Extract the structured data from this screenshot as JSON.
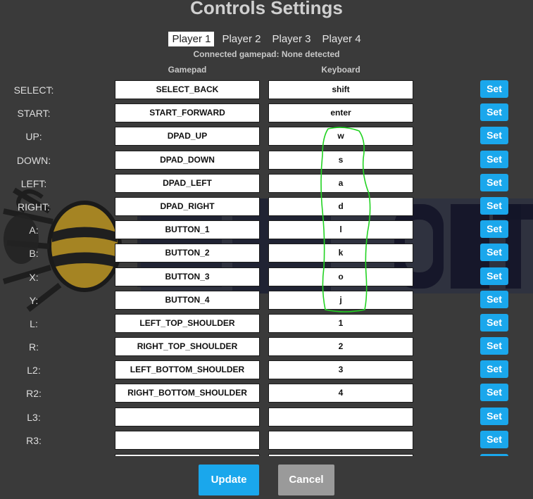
{
  "title": "Controls Settings",
  "tabs": [
    {
      "label": "Player 1",
      "active": true
    },
    {
      "label": "Player 2",
      "active": false
    },
    {
      "label": "Player 3",
      "active": false
    },
    {
      "label": "Player 4",
      "active": false
    }
  ],
  "connected_text": "Connected gamepad: None detected",
  "columns": {
    "gamepad": "Gamepad",
    "keyboard": "Keyboard"
  },
  "rows": [
    {
      "label": "SELECT:",
      "gamepad": "SELECT_BACK",
      "keyboard": "shift"
    },
    {
      "label": "START:",
      "gamepad": "START_FORWARD",
      "keyboard": "enter"
    },
    {
      "label": "UP:",
      "gamepad": "DPAD_UP",
      "keyboard": "w"
    },
    {
      "label": "DOWN:",
      "gamepad": "DPAD_DOWN",
      "keyboard": "s"
    },
    {
      "label": "LEFT:",
      "gamepad": "DPAD_LEFT",
      "keyboard": "a"
    },
    {
      "label": "RIGHT:",
      "gamepad": "DPAD_RIGHT",
      "keyboard": "d"
    },
    {
      "label": "A:",
      "gamepad": "BUTTON_1",
      "keyboard": "l"
    },
    {
      "label": "B:",
      "gamepad": "BUTTON_2",
      "keyboard": "k"
    },
    {
      "label": "X:",
      "gamepad": "BUTTON_3",
      "keyboard": "o"
    },
    {
      "label": "Y:",
      "gamepad": "BUTTON_4",
      "keyboard": "j"
    },
    {
      "label": "L:",
      "gamepad": "LEFT_TOP_SHOULDER",
      "keyboard": "1"
    },
    {
      "label": "R:",
      "gamepad": "RIGHT_TOP_SHOULDER",
      "keyboard": "2"
    },
    {
      "label": "L2:",
      "gamepad": "LEFT_BOTTOM_SHOULDER",
      "keyboard": "3"
    },
    {
      "label": "R2:",
      "gamepad": "RIGHT_BOTTOM_SHOULDER",
      "keyboard": "4"
    },
    {
      "label": "L3:",
      "gamepad": "",
      "keyboard": ""
    },
    {
      "label": "R3:",
      "gamepad": "",
      "keyboard": ""
    },
    {
      "label": "",
      "gamepad": "",
      "keyboard": ""
    }
  ],
  "set_label": "Set",
  "buttons": {
    "update": "Update",
    "cancel": "Cancel"
  },
  "colors": {
    "background": "#3a3a3a",
    "accent": "#1aa7ec",
    "cancel": "#9a9a9a",
    "annotation": "#22d322"
  }
}
